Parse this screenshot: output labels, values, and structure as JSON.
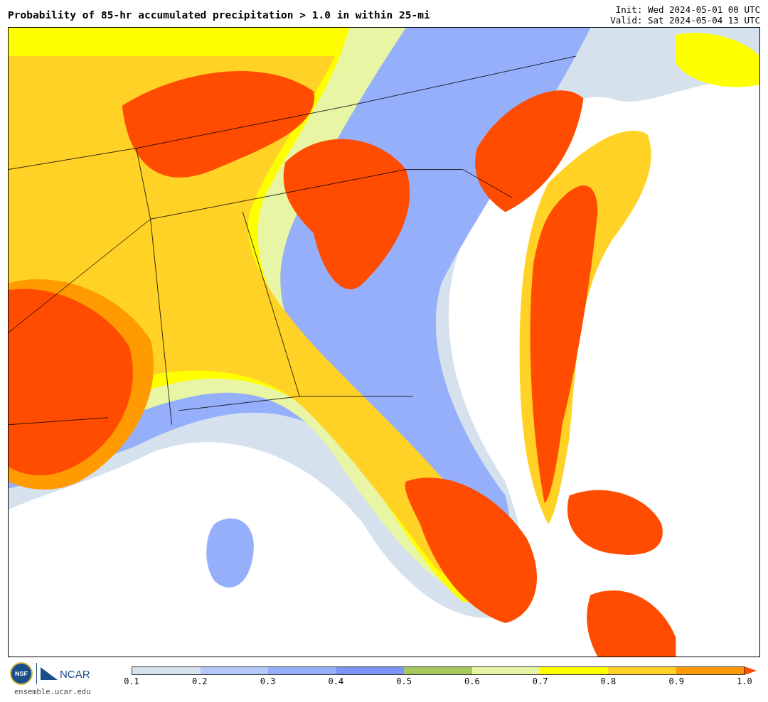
{
  "title": "Probability of 85-hr accumulated precipitation > 1.0 in within 25-mi",
  "init": "Init: Wed 2024-05-01 00 UTC",
  "valid": "Valid: Sat 2024-05-04 13 UTC",
  "logo": {
    "nsf": "NSF",
    "ncar": "NCAR",
    "url": "ensemble.ucar.edu"
  },
  "colorbar": {
    "segments": [
      {
        "color": "#d5e2ee"
      },
      {
        "color": "#b4c8fa"
      },
      {
        "color": "#96affa"
      },
      {
        "color": "#7a94fa"
      },
      {
        "color": "#a6c85e"
      },
      {
        "color": "#e8f5a4"
      },
      {
        "color": "#ffff00"
      },
      {
        "color": "#ffd225"
      },
      {
        "color": "#ff9a00"
      }
    ],
    "extend": {
      "color": "#ff4c00"
    },
    "ticks": [
      "0.1",
      "0.2",
      "0.3",
      "0.4",
      "0.5",
      "0.6",
      "0.7",
      "0.8",
      "0.9",
      "1.0"
    ]
  }
}
